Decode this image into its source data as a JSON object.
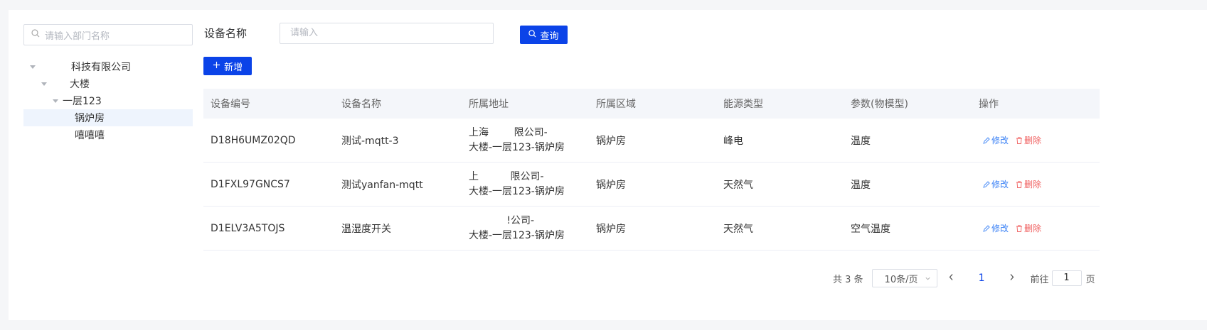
{
  "tree": {
    "search_placeholder": "请输入部门名称",
    "nodes": [
      {
        "label": "科技有限公司",
        "level": 0,
        "expanded": true,
        "selected": false
      },
      {
        "label": "大楼",
        "level": 1,
        "expanded": true,
        "selected": false
      },
      {
        "label": "一层123",
        "level": 2,
        "expanded": true,
        "selected": false
      },
      {
        "label": "锅炉房",
        "level": 3,
        "expanded": false,
        "selected": true
      },
      {
        "label": "嘻嘻嘻",
        "level": 3,
        "expanded": false,
        "selected": false
      }
    ]
  },
  "filter": {
    "label": "设备名称",
    "input_placeholder": "请输入",
    "query_label": "查询",
    "add_label": "新增"
  },
  "table": {
    "headers": [
      "设备编号",
      "设备名称",
      "所属地址",
      "所属区域",
      "能源类型",
      "参数(物模型)",
      "操作"
    ],
    "rows": [
      {
        "code": "D18H6UMZ02QD",
        "name": "测试-mqtt-3",
        "addr1": "上海        限公司-",
        "addr2": "大楼-一层123-锅炉房",
        "area": "锅炉房",
        "energy": "峰电",
        "param": "温度"
      },
      {
        "code": "D1FXL97GNCS7",
        "name": "测试yanfan-mqtt",
        "addr1": "上          限公司-",
        "addr2": "大楼-一层123-锅炉房",
        "area": "锅炉房",
        "energy": "天然气",
        "param": "温度"
      },
      {
        "code": "D1ELV3A5TOJS",
        "name": "温湿度开关",
        "addr1": "            !公司-",
        "addr2": "大楼-一层123-锅炉房",
        "area": "锅炉房",
        "energy": "天然气",
        "param": "空气温度"
      }
    ],
    "edit_label": "修改",
    "delete_label": "删除"
  },
  "pagination": {
    "total": "共 3 条",
    "page_size": "10条/页",
    "current_page": "1",
    "goto_label": "前往",
    "goto_value": "1",
    "page_suffix": "页"
  },
  "colors": {
    "primary": "#0b43e8",
    "edit": "#3b82f6",
    "delete": "#f05f5f",
    "selected_bg": "#eef4fd"
  },
  "icons": [
    "search-icon",
    "plus-icon",
    "edit-icon",
    "delete-icon",
    "chevron-down-icon",
    "chevron-left-icon",
    "chevron-right-icon",
    "caret-down-icon"
  ]
}
